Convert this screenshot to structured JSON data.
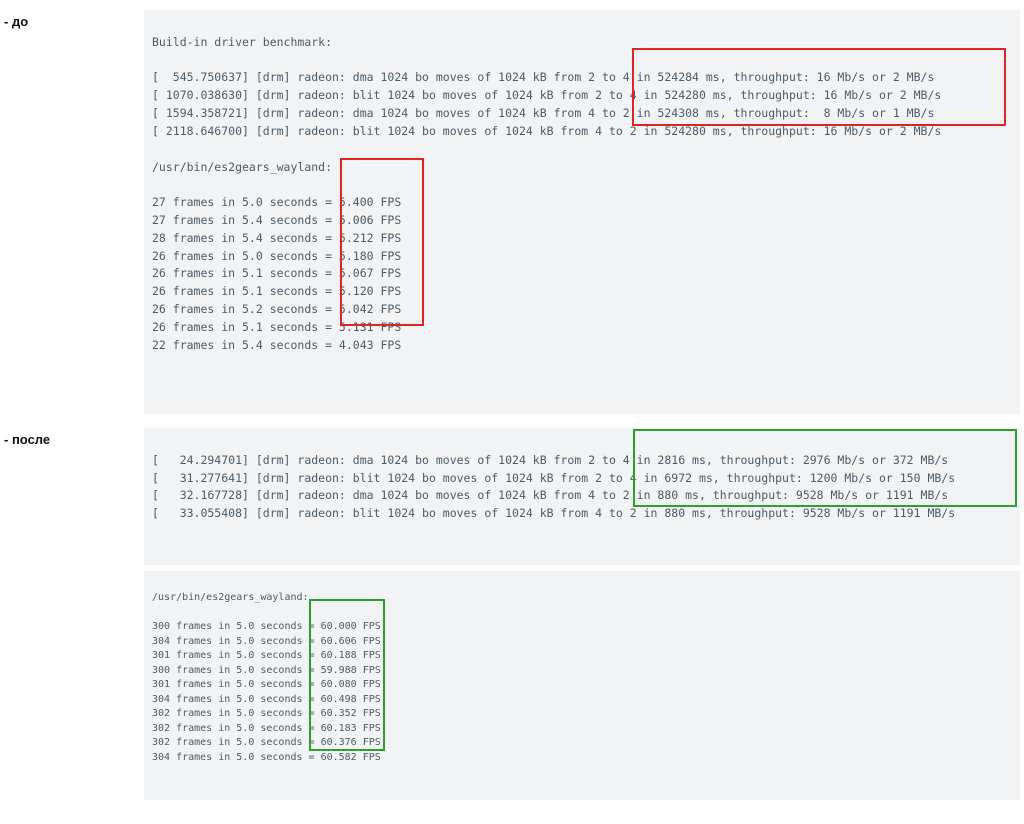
{
  "labels": {
    "before": "- до",
    "after": "- после"
  },
  "before": {
    "heading": "Build-in driver benchmark:",
    "dmesg": [
      "[  545.750637] [drm] radeon: dma 1024 bo moves of 1024 kB from 2 to 4 in 524284 ms, throughput: 16 Mb/s or 2 MB/s",
      "[ 1070.038630] [drm] radeon: blit 1024 bo moves of 1024 kB from 2 to 4 in 524280 ms, throughput: 16 Mb/s or 2 MB/s",
      "[ 1594.358721] [drm] radeon: dma 1024 bo moves of 1024 kB from 4 to 2 in 524308 ms, throughput:  8 Mb/s or 1 MB/s",
      "[ 2118.646700] [drm] radeon: blit 1024 bo moves of 1024 kB from 4 to 2 in 524280 ms, throughput: 16 Mb/s or 2 MB/s"
    ],
    "gears_title": "/usr/bin/es2gears_wayland:",
    "gears": [
      "27 frames in 5.0 seconds = 5.400 FPS",
      "27 frames in 5.4 seconds = 5.006 FPS",
      "28 frames in 5.4 seconds = 5.212 FPS",
      "26 frames in 5.0 seconds = 5.180 FPS",
      "26 frames in 5.1 seconds = 5.067 FPS",
      "26 frames in 5.1 seconds = 5.120 FPS",
      "26 frames in 5.2 seconds = 5.042 FPS",
      "26 frames in 5.1 seconds = 5.131 FPS",
      "22 frames in 5.4 seconds = 4.043 FPS"
    ]
  },
  "after": {
    "dmesg": [
      "[   24.294701] [drm] radeon: dma 1024 bo moves of 1024 kB from 2 to 4 in 2816 ms, throughput: 2976 Mb/s or 372 MB/s",
      "[   31.277641] [drm] radeon: blit 1024 bo moves of 1024 kB from 2 to 4 in 6972 ms, throughput: 1200 Mb/s or 150 MB/s",
      "[   32.167728] [drm] radeon: dma 1024 bo moves of 1024 kB from 4 to 2 in 880 ms, throughput: 9528 Mb/s or 1191 MB/s",
      "[   33.055408] [drm] radeon: blit 1024 bo moves of 1024 kB from 4 to 2 in 880 ms, throughput: 9528 Mb/s or 1191 MB/s"
    ],
    "gears_title": "/usr/bin/es2gears_wayland:",
    "gears": [
      "300 frames in 5.0 seconds = 60.000 FPS",
      "304 frames in 5.0 seconds = 60.606 FPS",
      "301 frames in 5.0 seconds = 60.188 FPS",
      "300 frames in 5.0 seconds = 59.988 FPS",
      "301 frames in 5.0 seconds = 60.080 FPS",
      "304 frames in 5.0 seconds = 60.498 FPS",
      "302 frames in 5.0 seconds = 60.352 FPS",
      "302 frames in 5.0 seconds = 60.183 FPS",
      "302 frames in 5.0 seconds = 60.376 FPS",
      "304 frames in 5.0 seconds = 60.582 FPS"
    ]
  }
}
